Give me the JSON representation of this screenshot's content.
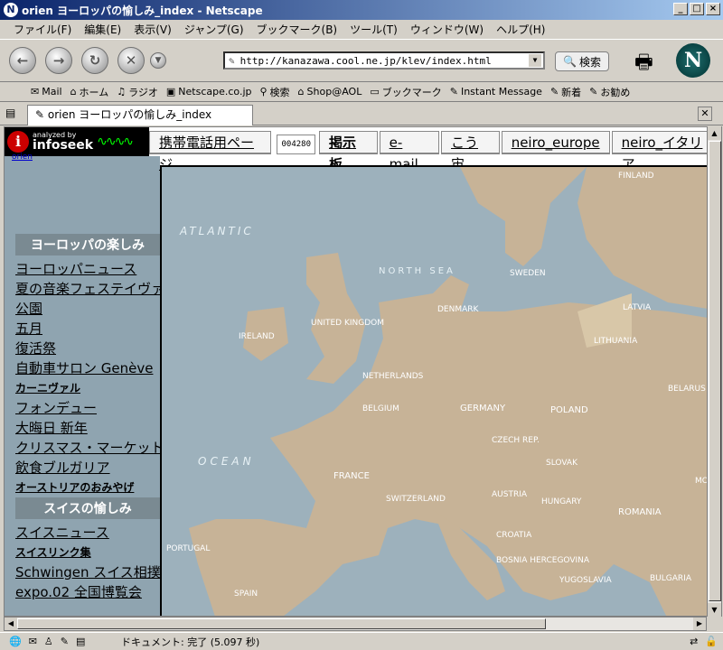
{
  "window": {
    "title": "orien ヨーロッパの愉しみ_index - Netscape",
    "controls": [
      "_",
      "□",
      "×"
    ]
  },
  "menu": [
    "ファイル(F)",
    "編集(E)",
    "表示(V)",
    "ジャンプ(G)",
    "ブックマーク(B)",
    "ツール(T)",
    "ウィンドウ(W)",
    "ヘルプ(H)"
  ],
  "navbar": {
    "url": "http://kanazawa.cool.ne.jp/klev/index.html",
    "search_label": "検索"
  },
  "bookmarks": [
    {
      "label": "Mail",
      "icon": "mail-icon"
    },
    {
      "label": "ホーム",
      "icon": "home-icon"
    },
    {
      "label": "ラジオ",
      "icon": "radio-icon"
    },
    {
      "label": "Netscape.co.jp",
      "icon": "my-icon"
    },
    {
      "label": "検索",
      "icon": "search-icon"
    },
    {
      "label": "Shop@AOL",
      "icon": "shop-icon"
    },
    {
      "label": "ブックマーク",
      "icon": "folder-icon"
    },
    {
      "label": "Instant Message",
      "icon": "bookmark-icon"
    },
    {
      "label": "新着",
      "icon": "bookmark-icon"
    },
    {
      "label": "お勧め",
      "icon": "bookmark-icon"
    }
  ],
  "tab": {
    "label": "orien ヨーロッパの愉しみ_index"
  },
  "page": {
    "infoseek_small": "analyzed by",
    "infoseek_brand": "infoseek",
    "small_link": "orien",
    "topnav": [
      "携帯電話用ページ",
      "004280",
      "掲示板",
      "e-mail",
      "こう宙",
      "neiro_europe",
      "neiro_イタリア"
    ],
    "section1": "ヨーロッパの楽しみ",
    "links1": [
      "ヨーロッパニュース",
      "夏の音楽フェステイヴァル",
      "公園",
      "五月",
      "復活祭",
      "自動車サロン Genève",
      "カーニヴァル",
      "フォンデュー",
      "大晦日 新年",
      "クリスマス・マーケット",
      "飲食ブルガリア",
      "オーストリアのおみやげ"
    ],
    "section2": "スイスの愉しみ",
    "links2": [
      "スイスニュース",
      "スイスリンク集",
      "Schwingen スイス相撲",
      "expo.02 全国博覧会"
    ]
  },
  "map": {
    "labels": [
      "ATLANTIC",
      "ATLANTIC",
      "OCEAN",
      "OCEAN",
      "NORTH SEA",
      "IRELAND",
      "UNITED KINGDOM",
      "DENMARK",
      "SWEDEN",
      "FINLAND",
      "LATVIA",
      "LITHUANIA",
      "BELARUS",
      "NETHERLANDS",
      "BELGIUM",
      "GERMANY",
      "POLAND",
      "CZECH REP.",
      "SLOVAK",
      "FRANCE",
      "SWITZERLAND",
      "AUSTRIA",
      "HUNGARY",
      "ROMANIA",
      "CROATIA",
      "BOSNIA HERCEGOVINA",
      "YUGOSLAVIA",
      "BULGARIA",
      "PORTUGAL",
      "SPAIN",
      "MOLDO"
    ]
  },
  "status": {
    "text": "ドキュメント: 完了 (5.097 秒)"
  },
  "colors": {
    "sea": "#9db1bc",
    "land": "#c7b397",
    "titlebar": "#0a246a"
  }
}
